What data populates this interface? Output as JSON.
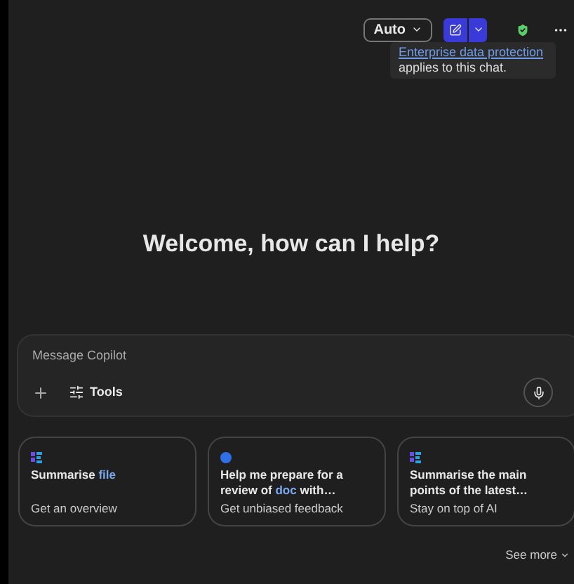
{
  "header": {
    "mode": "Auto",
    "tooltip": {
      "link": "Enterprise data protection",
      "text": " applies to this chat."
    }
  },
  "welcome": "Welcome, how can I help?",
  "composer": {
    "placeholder": "Message Copilot",
    "tools": "Tools"
  },
  "suggestions": [
    {
      "kind": "grid",
      "title": [
        {
          "text": "Summarise ",
          "highlight": false
        },
        {
          "text": "file",
          "highlight": true
        }
      ],
      "subtitle": "Get an overview"
    },
    {
      "kind": "bubble",
      "title": [
        {
          "text": "Help me prepare for a review of ",
          "highlight": false
        },
        {
          "text": "doc",
          "highlight": true
        },
        {
          "text": " with…",
          "highlight": false
        }
      ],
      "subtitle": "Get unbiased feedback"
    },
    {
      "kind": "grid",
      "title": [
        {
          "text": "Summarise the main points of the latest…",
          "highlight": false
        }
      ],
      "subtitle": "Stay on top of AI"
    }
  ],
  "see_more": "See more"
}
